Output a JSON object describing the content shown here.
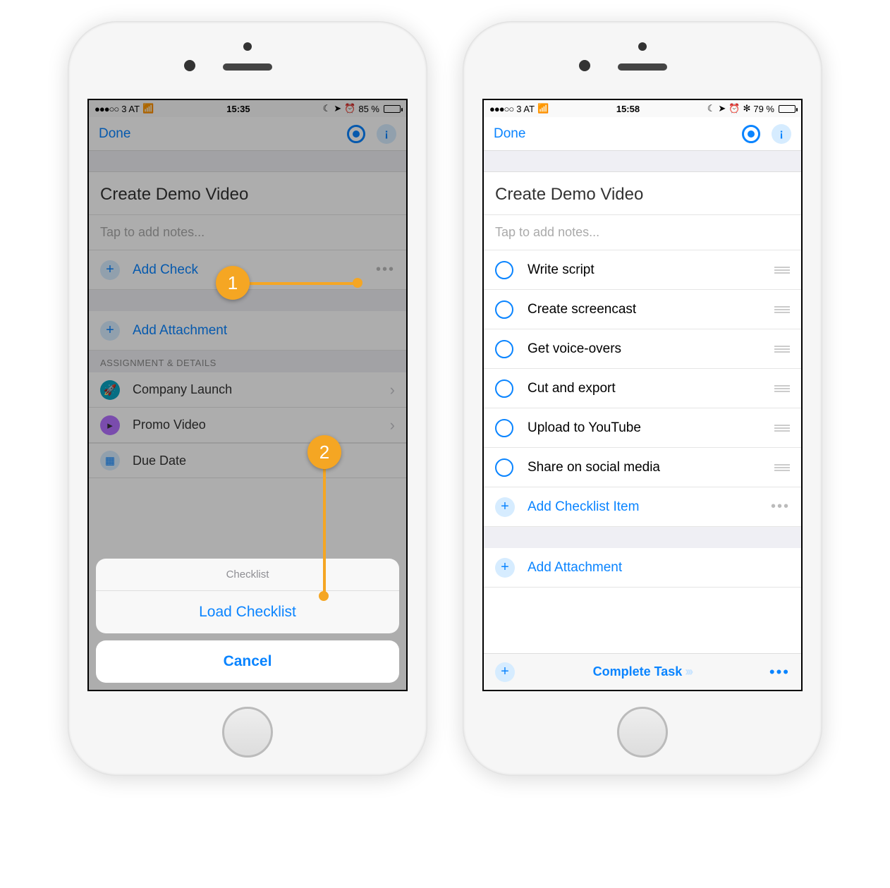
{
  "left": {
    "status": {
      "carrier": "3 AT",
      "signal": "●●●○○",
      "wifi": "✓",
      "time": "15:35",
      "moon": "☾",
      "loc": "➤",
      "alarm": "⏰",
      "battery_pct": "85 %",
      "battery_fill": 85
    },
    "nav": {
      "done": "Done"
    },
    "title": "Create Demo Video",
    "notes_placeholder": "Tap to add notes...",
    "add_check_label_partial": "Add Check",
    "add_attachment": "Add Attachment",
    "section_header": "ASSIGNMENT & DETAILS",
    "details": [
      {
        "label": "Company Launch",
        "icon_bg": "#0aa3c2",
        "icon_glyph": "👤"
      },
      {
        "label": "Promo Video",
        "icon_bg": "#b470ff",
        "icon_glyph": "📺"
      }
    ],
    "due_date": "Due Date",
    "sheet": {
      "title": "Checklist",
      "load": "Load Checklist",
      "cancel": "Cancel"
    },
    "callouts": {
      "one": "1",
      "two": "2"
    }
  },
  "right": {
    "status": {
      "carrier": "3 AT",
      "signal": "●●●○○",
      "time": "15:58",
      "moon": "☾",
      "loc": "➤",
      "alarm": "⏰",
      "bt": "✻",
      "battery_pct": "79 %",
      "battery_fill": 79
    },
    "nav": {
      "done": "Done"
    },
    "title": "Create Demo Video",
    "notes_placeholder": "Tap to add notes...",
    "checklist": [
      "Write script",
      "Create screencast",
      "Get voice-overs",
      "Cut and export",
      "Upload to YouTube",
      "Share on social media"
    ],
    "add_item": "Add Checklist Item",
    "add_attachment": "Add Attachment",
    "complete": "Complete Task"
  }
}
